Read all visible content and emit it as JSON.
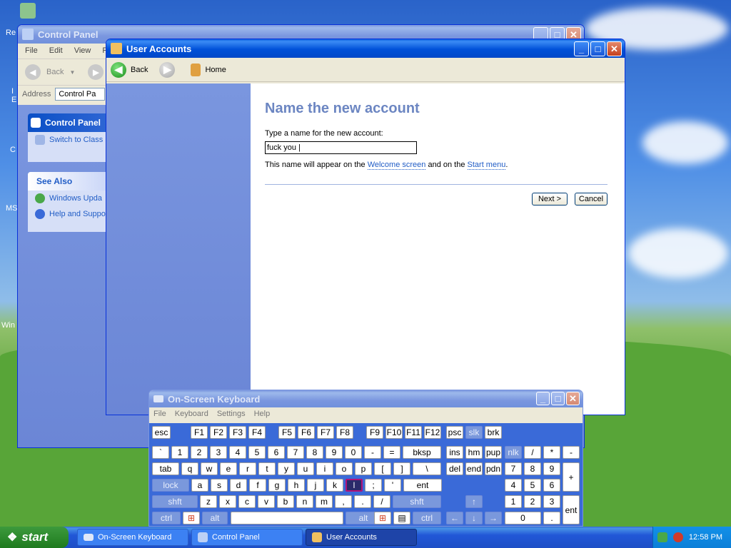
{
  "control_panel": {
    "title": "Control Panel",
    "menu": [
      "File",
      "Edit",
      "View",
      "F"
    ],
    "back_label": "Back",
    "address_label": "Address",
    "address_value": "Control Pa",
    "panel_title": "Control Panel",
    "switch_label": "Switch to Class",
    "see_also_title": "See Also",
    "see_also_items": [
      "Windows Upda",
      "Help and Suppo"
    ]
  },
  "user_accounts": {
    "title": "User Accounts",
    "back_label": "Back",
    "home_label": "Home",
    "heading": "Name the new account",
    "prompt": "Type a name for the new account:",
    "input_value": "fuck you |",
    "note_prefix": "This name will appear on the ",
    "note_link1": "Welcome screen",
    "note_middle": " and on the ",
    "note_link2": "Start menu",
    "note_suffix": ".",
    "next_label": "Next >",
    "cancel_label": "Cancel"
  },
  "osk": {
    "title": "On-Screen Keyboard",
    "menu": [
      "File",
      "Keyboard",
      "Settings",
      "Help"
    ]
  },
  "taskbar": {
    "start_label": "start",
    "buttons": [
      "On-Screen Keyboard",
      "Control Panel",
      "User Accounts"
    ],
    "clock": "12:58 PM"
  },
  "desktop_labels": [
    "Re",
    "I",
    "E",
    "C",
    "MS",
    "Win"
  ],
  "colors": {
    "title_active": "#0050d8",
    "heading": "#6c86c2",
    "osk_bg": "#3a6ad8"
  }
}
